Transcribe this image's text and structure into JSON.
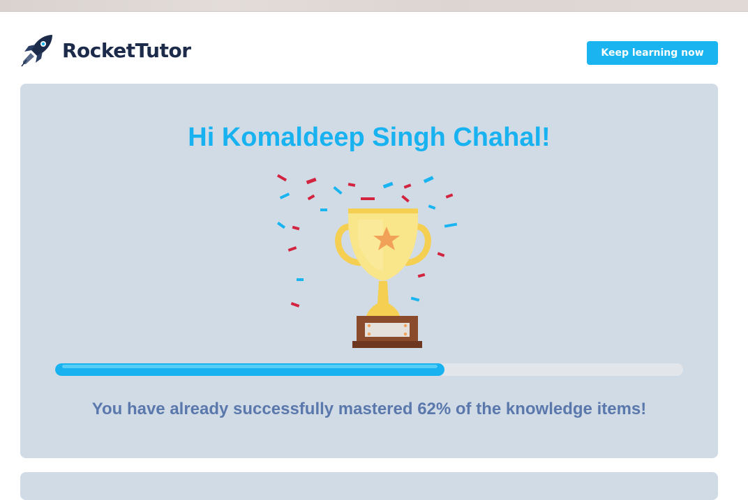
{
  "header": {
    "brand_name": "RocketTutor",
    "cta_label": "Keep learning now"
  },
  "main_card": {
    "greeting": "Hi Komaldeep Singh Chahal!",
    "mastery_message": "You have already successfully mastered 62% of the knowledge items!",
    "progress_fraction": 0.62
  },
  "icons": {
    "logo": "rocket-icon",
    "illustration": "trophy-icon"
  },
  "colors": {
    "accent": "#1ab5f1",
    "brand_text": "#1d2b4a",
    "card_bg": "#d1dbe6",
    "message_text": "#5a78ac",
    "confetti_red": "#d2243f",
    "confetti_blue": "#1ab5f1",
    "trophy_gold": "#f7d54a"
  }
}
